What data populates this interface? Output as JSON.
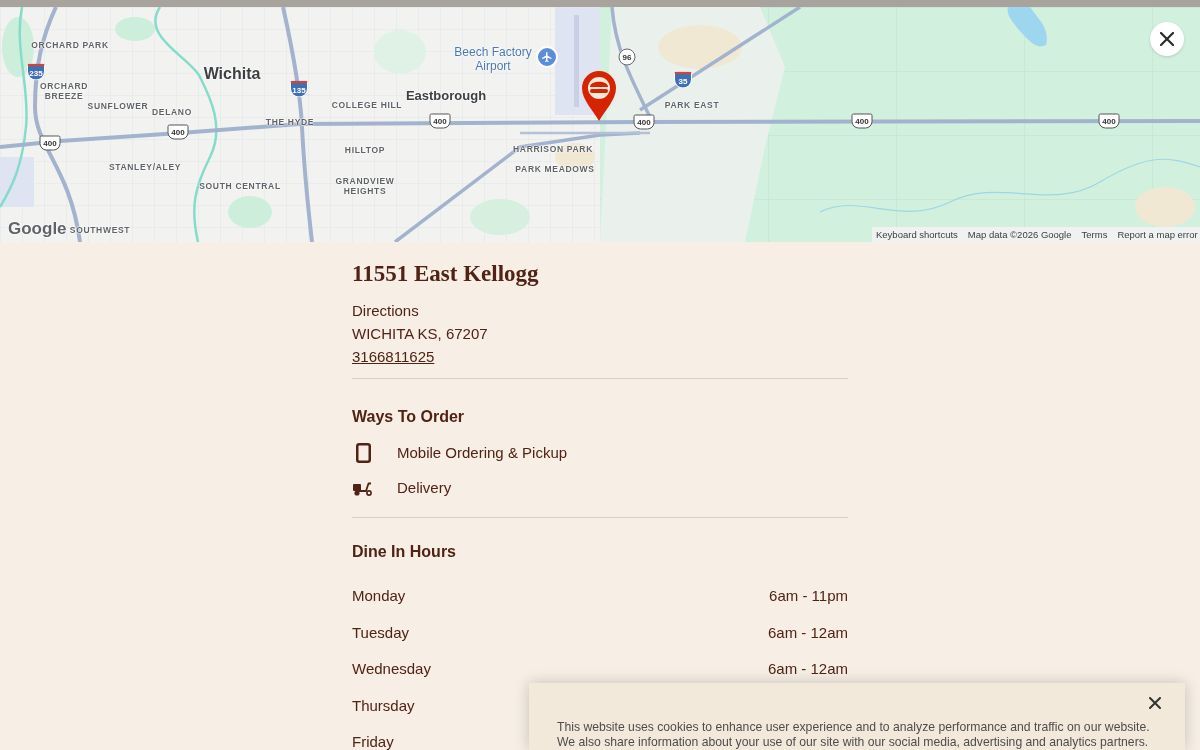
{
  "map": {
    "labels": [
      {
        "text": "ORCHARD PARK",
        "kind": "neighborhood"
      },
      {
        "text": "Beech Factory Airport",
        "kind": "airport"
      },
      {
        "text": "Wichita",
        "kind": "city"
      },
      {
        "text": "ORCHARD BREEZE",
        "kind": "neighborhood"
      },
      {
        "text": "Eastborough",
        "kind": "town"
      },
      {
        "text": "SUNFLOWER",
        "kind": "neighborhood"
      },
      {
        "text": "DELANO",
        "kind": "neighborhood"
      },
      {
        "text": "COLLEGE HILL",
        "kind": "neighborhood"
      },
      {
        "text": "PARK EAST",
        "kind": "neighborhood"
      },
      {
        "text": "THE HYDE",
        "kind": "neighborhood"
      },
      {
        "text": "HILLTOP",
        "kind": "neighborhood"
      },
      {
        "text": "HARRISON PARK",
        "kind": "neighborhood"
      },
      {
        "text": "STANLEY/ALEY",
        "kind": "neighborhood"
      },
      {
        "text": "PARK MEADOWS",
        "kind": "neighborhood"
      },
      {
        "text": "SOUTH CENTRAL",
        "kind": "neighborhood"
      },
      {
        "text": "GRANDVIEW HEIGHTS",
        "kind": "neighborhood"
      },
      {
        "text": "SOUTHWEST",
        "kind": "neighborhood"
      }
    ],
    "shields": [
      {
        "number": "96",
        "kind": "state"
      },
      {
        "number": "235",
        "kind": "interstate"
      },
      {
        "number": "35",
        "kind": "interstate"
      },
      {
        "number": "135",
        "kind": "interstate"
      },
      {
        "number": "400",
        "kind": "us"
      },
      {
        "number": "400",
        "kind": "us"
      },
      {
        "number": "400",
        "kind": "us"
      },
      {
        "number": "400",
        "kind": "us"
      },
      {
        "number": "400",
        "kind": "us"
      },
      {
        "number": "400",
        "kind": "us"
      }
    ],
    "logo": "Google",
    "attribution": {
      "shortcuts": "Keyboard shortcuts",
      "map_data": "Map data ©2026 Google",
      "links": [
        "Terms",
        "Report a map error"
      ]
    }
  },
  "store": {
    "name": "11551 East Kellogg",
    "directions": "Directions",
    "address": "WICHITA KS, 67207",
    "phone": "3166811625"
  },
  "ways_to_order": {
    "title": "Ways To Order",
    "options": [
      {
        "kind": "mobile",
        "label": "Mobile Ordering & Pickup"
      },
      {
        "kind": "delivery",
        "label": "Delivery"
      }
    ]
  },
  "dine_in_hours": {
    "title": "Dine In Hours",
    "days": [
      {
        "day": "Monday",
        "hours": "6am - 11pm"
      },
      {
        "day": "Tuesday",
        "hours": "6am - 12am"
      },
      {
        "day": "Wednesday",
        "hours": "6am - 12am"
      },
      {
        "day": "Thursday"
      },
      {
        "day": "Friday"
      }
    ]
  },
  "cookie_banner": {
    "text": "This website uses cookies to enhance user experience and to analyze performance and traffic on our website. We also share information about your use of our site with our social media, advertising and analytics partners."
  }
}
